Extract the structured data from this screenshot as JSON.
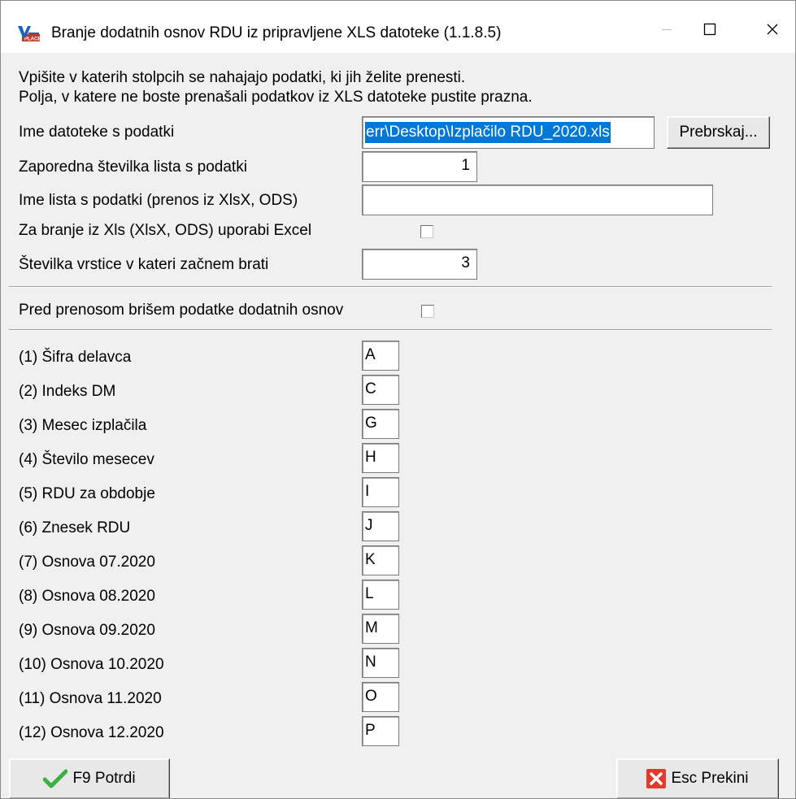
{
  "window": {
    "title": "Branje dodatnih osnov RDU iz pripravljene XLS datoteke  (1.1.8.5)",
    "icon": "vasco-app-icon"
  },
  "intro": {
    "line1": "Vpišite v katerih stolpcih se nahajajo podatki, ki jih želite prenesti.",
    "line2": "Polja, v katere ne boste prenašali podatkov iz XLS datoteke pustite prazna."
  },
  "form": {
    "file_label": "Ime datoteke s podatki",
    "file_value": "err\\Desktop\\Izplačilo RDU_2020.xls",
    "browse_label": "Prebrskaj...",
    "sheet_no_label": "Zaporedna številka lista s podatki",
    "sheet_no_value": "1",
    "sheet_name_label": "Ime lista s podatki (prenos iz XlsX, ODS)",
    "sheet_name_value": "",
    "excel_label": "Za branje iz Xls (XlsX, ODS) uporabi Excel",
    "excel_checked": false,
    "start_row_label": "Številka vrstice v kateri začnem brati",
    "start_row_value": "3",
    "delete_label": "Pred prenosom brišem podatke dodatnih osnov",
    "delete_checked": false
  },
  "columns": [
    {
      "label": "(1) Šifra delavca",
      "value": "A"
    },
    {
      "label": "(2) Indeks DM",
      "value": "C"
    },
    {
      "label": "(3) Mesec izplačila",
      "value": "G"
    },
    {
      "label": "(4) Število mesecev",
      "value": "H"
    },
    {
      "label": "(5) RDU za obdobje",
      "value": "I"
    },
    {
      "label": "(6) Znesek RDU",
      "value": "J"
    },
    {
      "label": "(7) Osnova 07.2020",
      "value": "K"
    },
    {
      "label": "(8) Osnova 08.2020",
      "value": "L"
    },
    {
      "label": "(9) Osnova 09.2020",
      "value": "M"
    },
    {
      "label": "(10) Osnova 10.2020",
      "value": "N"
    },
    {
      "label": "(11) Osnova 11.2020",
      "value": "O"
    },
    {
      "label": "(12) Osnova 12.2020",
      "value": "P"
    }
  ],
  "buttons": {
    "confirm": "F9 Potrdi",
    "cancel": "Esc Prekini"
  },
  "colors": {
    "selection": "#0078d7",
    "confirm_check": "#3cb043",
    "cancel_red": "#e23b2e"
  }
}
